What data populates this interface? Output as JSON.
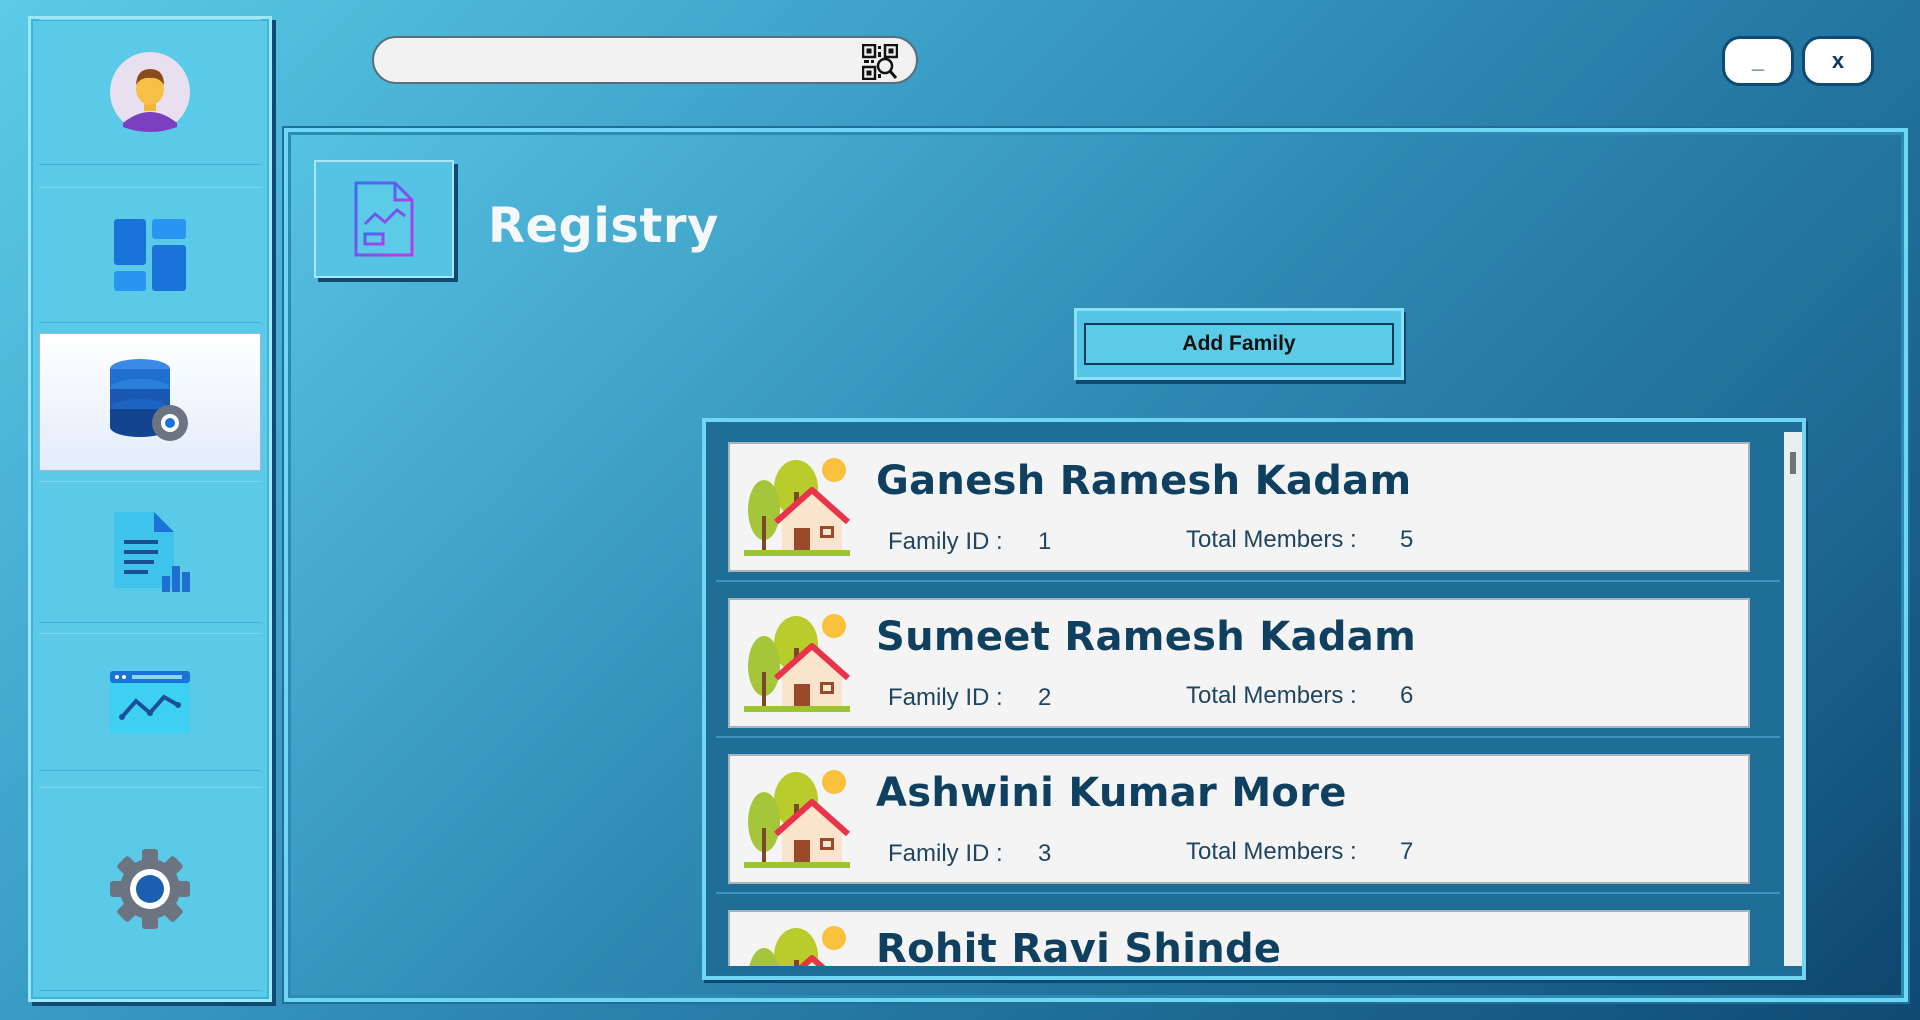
{
  "search": {
    "value": "",
    "icon": "qr-scan-icon"
  },
  "window": {
    "minimize_label": "_",
    "close_label": "x"
  },
  "sidebar": {
    "items": [
      {
        "name": "profile",
        "icon": "user-avatar-icon"
      },
      {
        "name": "dashboard",
        "icon": "dashboard-icon"
      },
      {
        "name": "registry",
        "icon": "database-settings-icon",
        "active": true
      },
      {
        "name": "reports",
        "icon": "report-document-icon"
      },
      {
        "name": "analytics",
        "icon": "analytics-chart-icon"
      },
      {
        "name": "settings",
        "icon": "gear-icon"
      }
    ]
  },
  "page": {
    "title": "Registry",
    "icon": "report-document-chart-icon"
  },
  "actions": {
    "add_family_label": "Add Family"
  },
  "labels": {
    "family_id": "Family ID :",
    "total_members": "Total Members :"
  },
  "families": [
    {
      "name": "Ganesh Ramesh Kadam",
      "id": "1",
      "members": "5"
    },
    {
      "name": "Sumeet Ramesh Kadam",
      "id": "2",
      "members": "6"
    },
    {
      "name": "Ashwini Kumar More",
      "id": "3",
      "members": "7"
    },
    {
      "name": "Rohit Ravi Shinde",
      "id": "",
      "members": ""
    }
  ],
  "colors": {
    "accent": "#5bc9e8",
    "dark": "#0f4a72",
    "name_text": "#10405f"
  }
}
